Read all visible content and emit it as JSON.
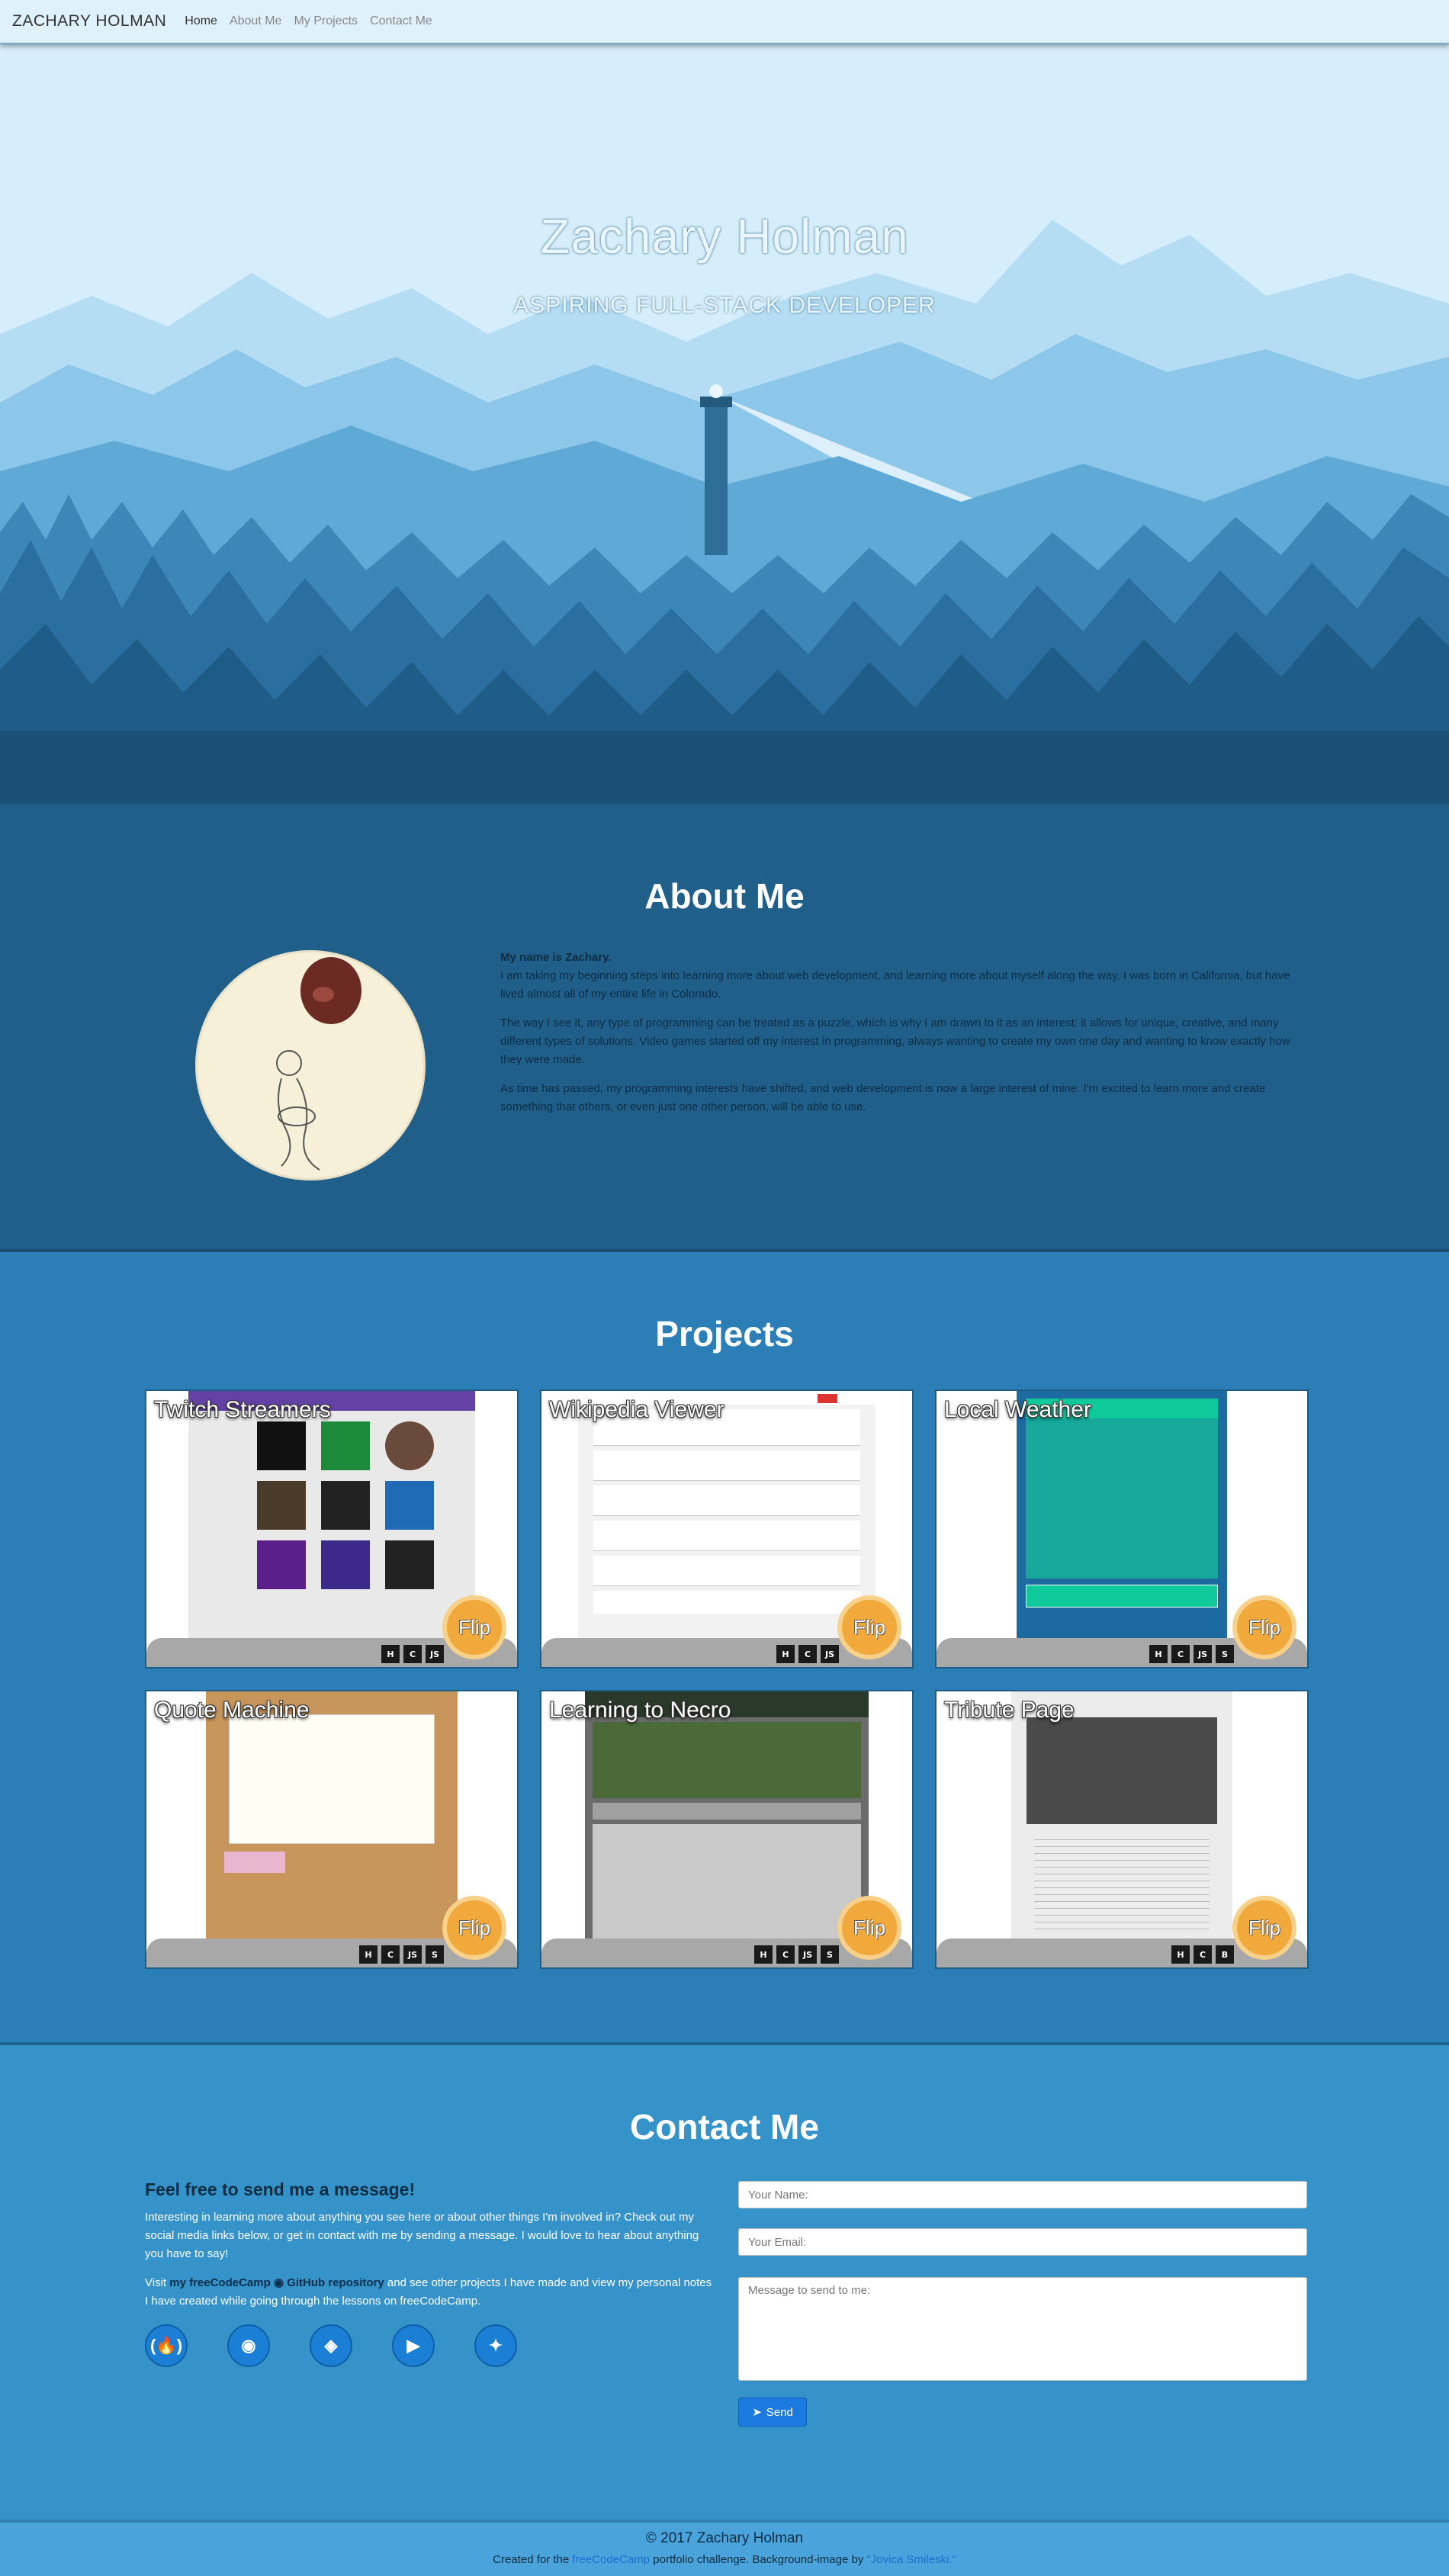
{
  "navbar": {
    "brand": "ZACHARY HOLMAN",
    "links": [
      "Home",
      "About Me",
      "My Projects",
      "Contact Me"
    ]
  },
  "hero": {
    "title": "Zachary Holman",
    "subtitle": "ASPIRING FULL-STACK DEVELOPER"
  },
  "about": {
    "heading": "About Me",
    "name_line": "My name is Zachary.",
    "para1": "I am taking my beginning steps into learning more about web development, and learning more about myself along the way. I was born in California, but have lived almost all of my entire life in Colorado.",
    "para2": "The way I see it, any type of programming can be treated as a puzzle, which is why I am drawn to it as an interest: it allows for unique, creative, and many different types of solutions. Video games started off my interest in programming, always wanting to create my own one day and wanting to know exactly how they were made.",
    "para3": "As time has passed, my programming interests have shifted, and web development is now a large interest of mine. I'm excited to learn more and create something that others, or even just one other person, will be able to use."
  },
  "projects": {
    "heading": "Projects",
    "flip_label": "Flip",
    "cards": [
      {
        "title": "Twitch Streamers",
        "badges": [
          "H",
          "C",
          "JS"
        ]
      },
      {
        "title": "Wikipedia Viewer",
        "badges": [
          "H",
          "C",
          "JS"
        ]
      },
      {
        "title": "Local Weather",
        "badges": [
          "H",
          "C",
          "JS",
          "S"
        ]
      },
      {
        "title": "Quote Machine",
        "badges": [
          "H",
          "C",
          "JS",
          "S"
        ]
      },
      {
        "title": "Learning to Necro",
        "badges": [
          "H",
          "C",
          "JS",
          "S"
        ]
      },
      {
        "title": "Tribute Page",
        "badges": [
          "H",
          "C",
          "B"
        ]
      }
    ]
  },
  "contact": {
    "heading": "Contact Me",
    "lead": "Feel free to send me a message!",
    "para1": "Interesting in learning more about anything you see here or about other things I'm involved in? Check out my social media links below, or get in contact with me by sending a message. I would love to hear about anything you have to say!",
    "para2_prefix": "Visit ",
    "link_fcc": "my freeCodeCamp",
    "link_github": "GitHub repository",
    "para2_suffix": " and see other projects I have made and view my personal notes I have created while going through the lessons on freeCodeCamp.",
    "name_placeholder": "Your Name:",
    "email_placeholder": "Your Email:",
    "message_placeholder": "Message to send to me:",
    "send_label": "Send",
    "socials": [
      "freecodecamp-icon",
      "github-icon",
      "codepen-icon",
      "youtube-icon",
      "twitter-icon"
    ]
  },
  "footer": {
    "copyright": "© 2017 Zachary Holman",
    "credit_prefix": "Created for the ",
    "credit_fcc": "freeCodeCamp",
    "credit_mid": " portfolio challenge. Background-image by ",
    "credit_artist": "\"Jovica Smileski.\""
  }
}
